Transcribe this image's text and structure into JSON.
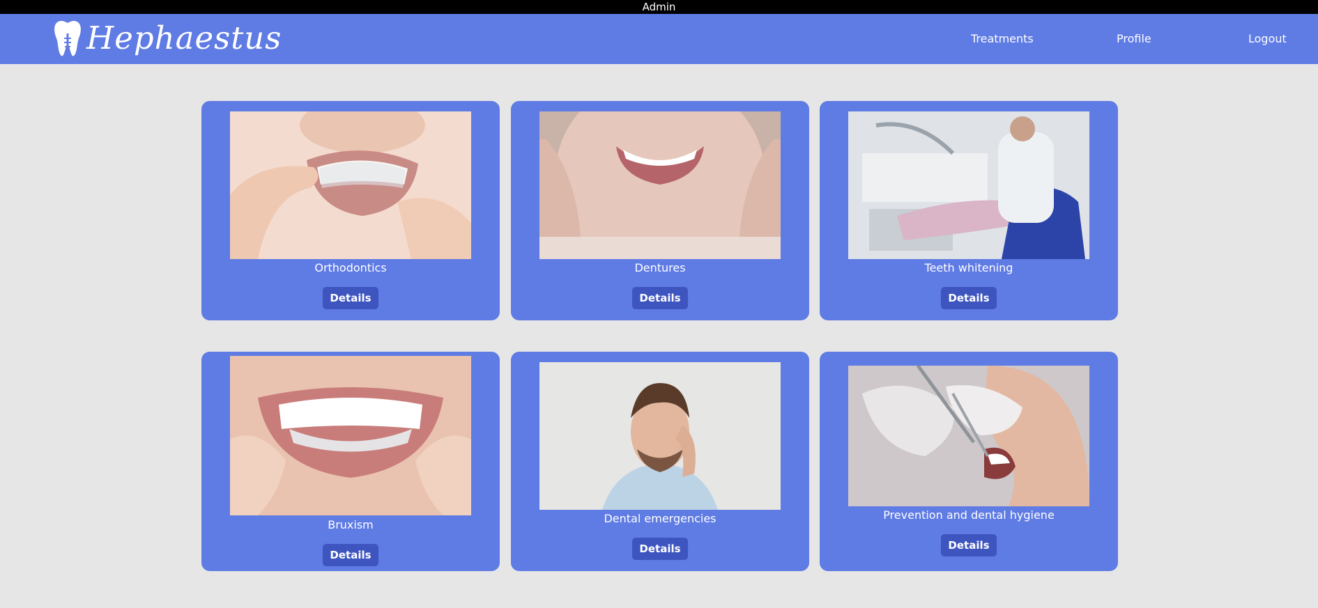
{
  "topbar": {
    "role_label": "Admin"
  },
  "header": {
    "logo_text": "Hephaestus",
    "nav": {
      "treatments": "Treatments",
      "profile": "Profile",
      "logout": "Logout"
    }
  },
  "colors": {
    "navbar": "#5f7be4",
    "card": "#5f7be4",
    "button": "#3e55c0",
    "background": "#e6e6e6"
  },
  "treatments": [
    {
      "title": "Orthodontics",
      "button": "Details",
      "image": "aligner-teeth-photo"
    },
    {
      "title": "Dentures",
      "button": "Details",
      "image": "smiling-senior-woman-photo"
    },
    {
      "title": "Teeth whitening",
      "button": "Details",
      "image": "dentist-with-patient-photo"
    },
    {
      "title": "Bruxism",
      "button": "Details",
      "image": "mouthguard-teeth-photo"
    },
    {
      "title": "Dental emergencies",
      "button": "Details",
      "image": "man-with-toothache-photo"
    },
    {
      "title": "Prevention and dental hygiene",
      "button": "Details",
      "image": "dental-cleaning-photo"
    }
  ]
}
